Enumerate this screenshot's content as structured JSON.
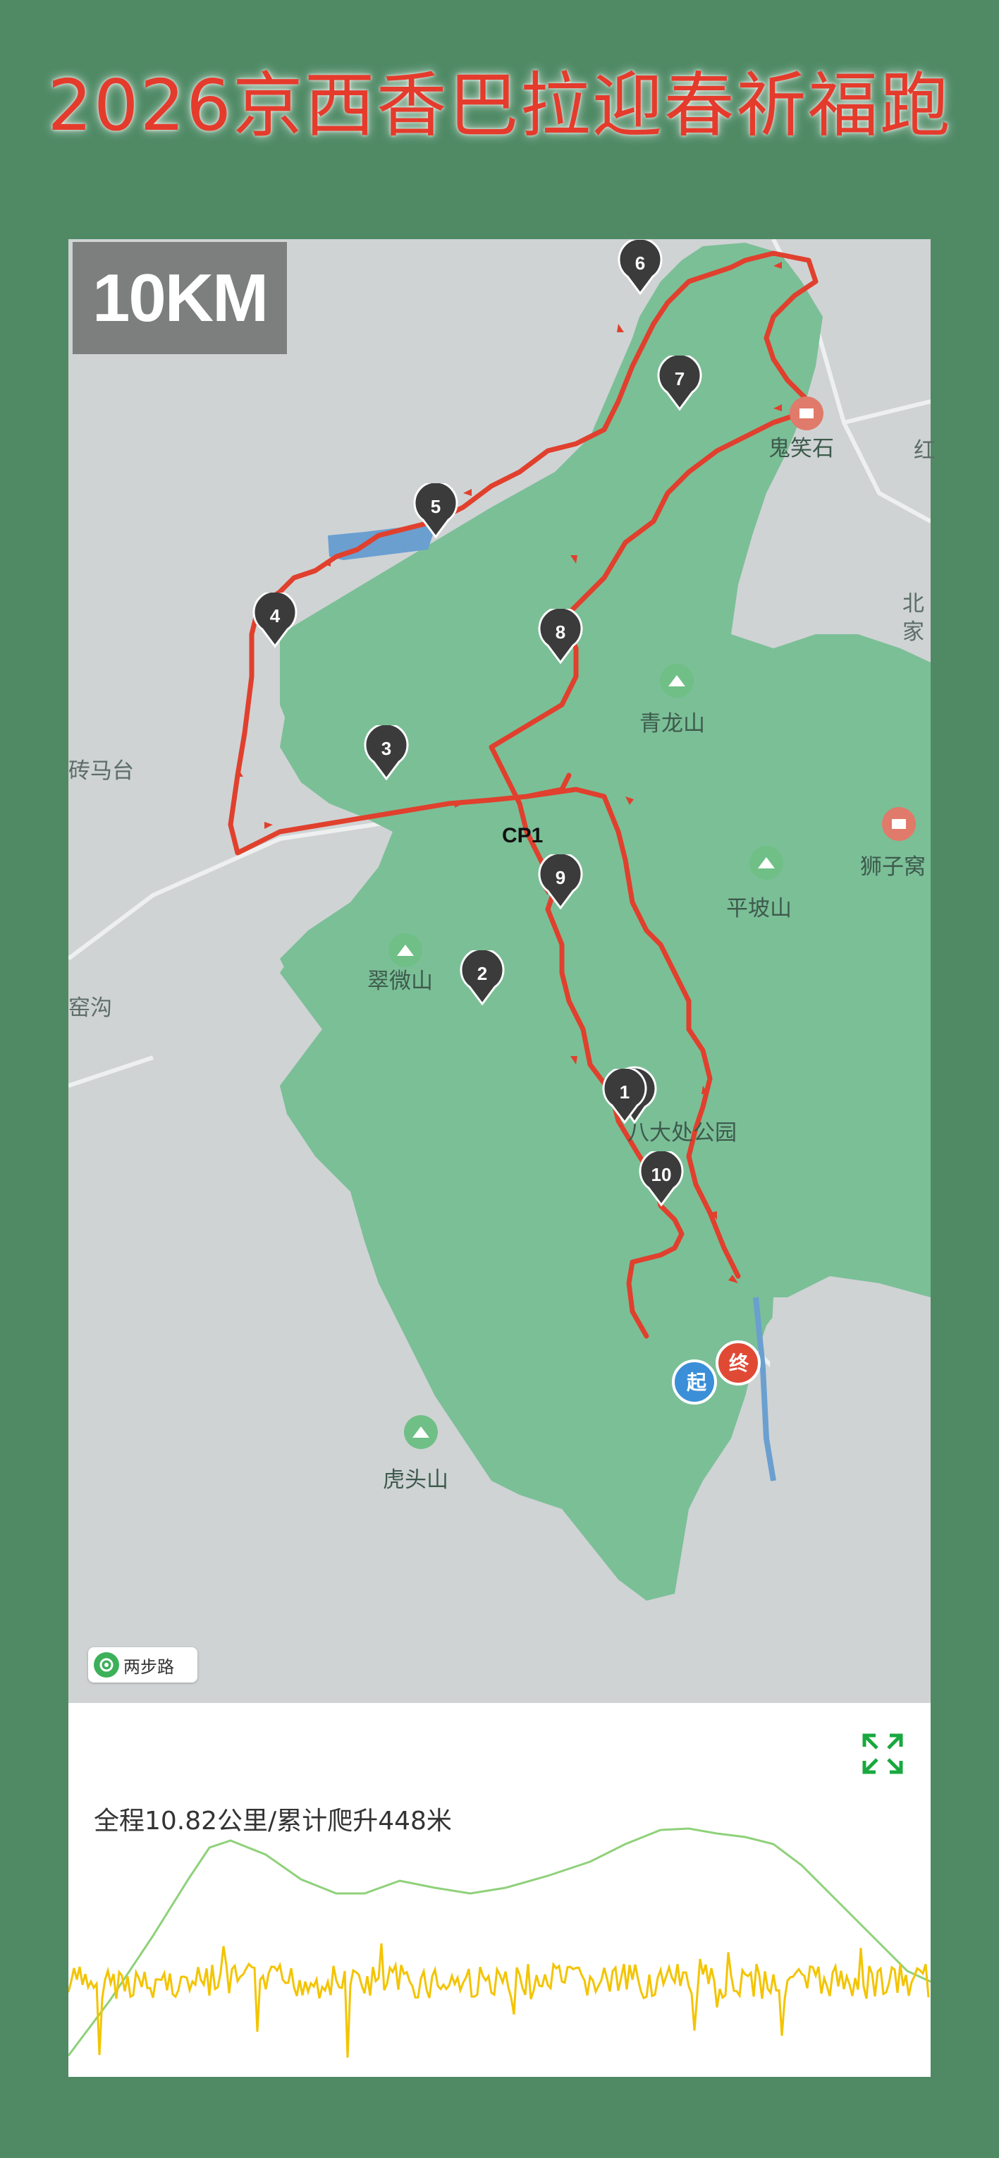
{
  "title": "2026京西香巴拉迎春祈福跑",
  "map": {
    "distance_badge": "10KM",
    "cp_label": "CP1",
    "watermark": "两步路",
    "start_marker": "起",
    "end_marker": "终",
    "waypoints": [
      "1",
      "2",
      "3",
      "4",
      "5",
      "6",
      "7",
      "8",
      "9",
      "10"
    ],
    "places": {
      "guixiaoshi": "鬼笑石",
      "qinglongshan": "青龙山",
      "shizi": "狮子窝",
      "pingposhan": "平坡山",
      "cuiweishan": "翠微山",
      "badachu": "八大处公园",
      "hutoushan": "虎头山",
      "zhuanmatai": "砖马台",
      "yaogou": "窑沟",
      "edge_hong": "红",
      "edge_bei": "北",
      "edge_jia": "家"
    },
    "colors": {
      "route": "#e0402d",
      "pin": "#3b3b3b",
      "green": "#7bbf97",
      "gray": "#cfd3d4",
      "lake": "#6a9fd0",
      "start": "#3a8fd8",
      "end": "#e04a35"
    }
  },
  "elevation": {
    "summary": "全程10.82公里/累计爬升448米",
    "total_km": 10.82,
    "ascent_m": 448,
    "elevation_line_color": "#8fd17a",
    "pace_line_color": "#f3c400",
    "expand_icon": "expand-icon"
  }
}
